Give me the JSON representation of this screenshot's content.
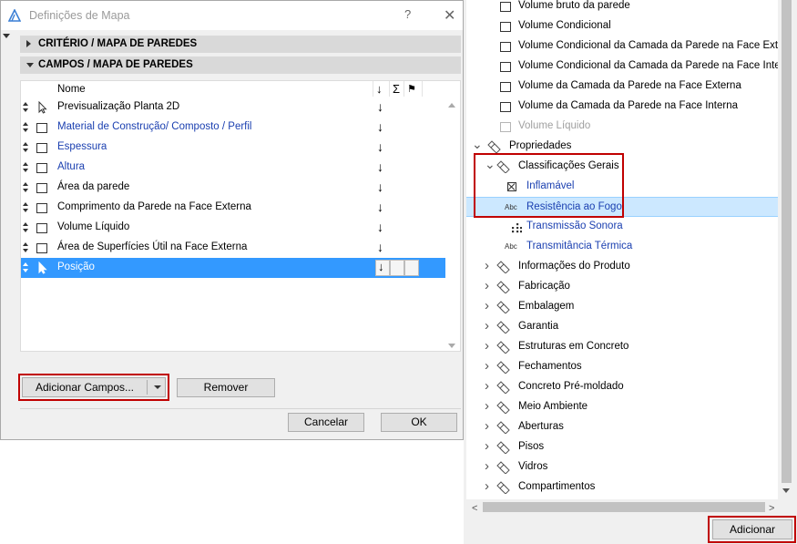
{
  "dialog": {
    "title": "Definições de Mapa",
    "help": "?",
    "close": "✕"
  },
  "sections": {
    "criterio": "CRITÉRIO / MAPA DE PAREDES",
    "campos": "CAMPOS / MAPA DE PAREDES"
  },
  "table": {
    "header": {
      "name": "Nome",
      "sort": "↓",
      "sum": "Σ",
      "flag": "⚑"
    },
    "rows": [
      {
        "label": "Previsualização Planta 2D",
        "sort": "↓",
        "icon": "cursor-icon"
      },
      {
        "label": "Material de Construção/ Composto / Perfil",
        "sort": "↓",
        "icon": "checkbox-icon"
      },
      {
        "label": "Espessura",
        "sort": "↓",
        "icon": "checkbox-icon"
      },
      {
        "label": "Altura",
        "sort": "↓",
        "icon": "checkbox-icon"
      },
      {
        "label": "Área da parede",
        "sort": "↓",
        "icon": "checkbox-icon"
      },
      {
        "label": "Comprimento da Parede na Face Externa",
        "sort": "↓",
        "icon": "checkbox-icon"
      },
      {
        "label": "Volume Líquido",
        "sort": "↓",
        "icon": "checkbox-icon"
      },
      {
        "label": "Área de Superfícies Útil na Face Externa",
        "sort": "↓",
        "icon": "checkbox-icon"
      },
      {
        "label": "Posição",
        "sort": "↓",
        "icon": "cursor-icon",
        "selected": true
      }
    ]
  },
  "buttons": {
    "add_fields": "Adicionar Campos...",
    "remove": "Remover",
    "cancel": "Cancelar",
    "ok": "OK",
    "add": "Adicionar"
  },
  "tree": {
    "items": [
      {
        "label": "Volume bruto da parede",
        "kind": "checkbox"
      },
      {
        "label": "Volume Condicional",
        "kind": "checkbox"
      },
      {
        "label": "Volume Condicional da Camada da Parede na Face Externa",
        "kind": "checkbox"
      },
      {
        "label": "Volume Condicional da Camada da Parede na Face Interna",
        "kind": "checkbox"
      },
      {
        "label": "Volume da Camada da Parede na Face Externa",
        "kind": "checkbox"
      },
      {
        "label": "Volume da Camada da Parede na Face Interna",
        "kind": "checkbox"
      },
      {
        "label": "Volume Líquido",
        "kind": "checkbox",
        "disabled": true
      },
      {
        "label": "Propriedades",
        "kind": "tag-group",
        "expanded": true
      },
      {
        "label": "Classificações Gerais",
        "kind": "tag-group",
        "expanded": true
      },
      {
        "label": "Inflamável",
        "kind": "boolean"
      },
      {
        "label": "Resistência ao Fogo",
        "kind": "abc",
        "selected": true
      },
      {
        "label": "Transmissão Sonora",
        "kind": "grid"
      },
      {
        "label": "Transmitância Térmica",
        "kind": "abc"
      },
      {
        "label": "Informações do Produto",
        "kind": "tag-group"
      },
      {
        "label": "Fabricação",
        "kind": "tag-group"
      },
      {
        "label": "Embalagem",
        "kind": "tag-group"
      },
      {
        "label": "Garantia",
        "kind": "tag-group"
      },
      {
        "label": "Estruturas em Concreto",
        "kind": "tag-group"
      },
      {
        "label": "Fechamentos",
        "kind": "tag-group"
      },
      {
        "label": "Concreto Pré-moldado",
        "kind": "tag-group"
      },
      {
        "label": "Meio Ambiente",
        "kind": "tag-group"
      },
      {
        "label": "Aberturas",
        "kind": "tag-group"
      },
      {
        "label": "Pisos",
        "kind": "tag-group"
      },
      {
        "label": "Vidros",
        "kind": "tag-group"
      },
      {
        "label": "Compartimentos",
        "kind": "tag-group"
      }
    ],
    "abc_badge": "Abc"
  },
  "colors": {
    "selection": "#3399ff",
    "tree_selection": "#cce8ff",
    "link_blue": "#1a3fb0",
    "highlight_red": "#c00000"
  }
}
